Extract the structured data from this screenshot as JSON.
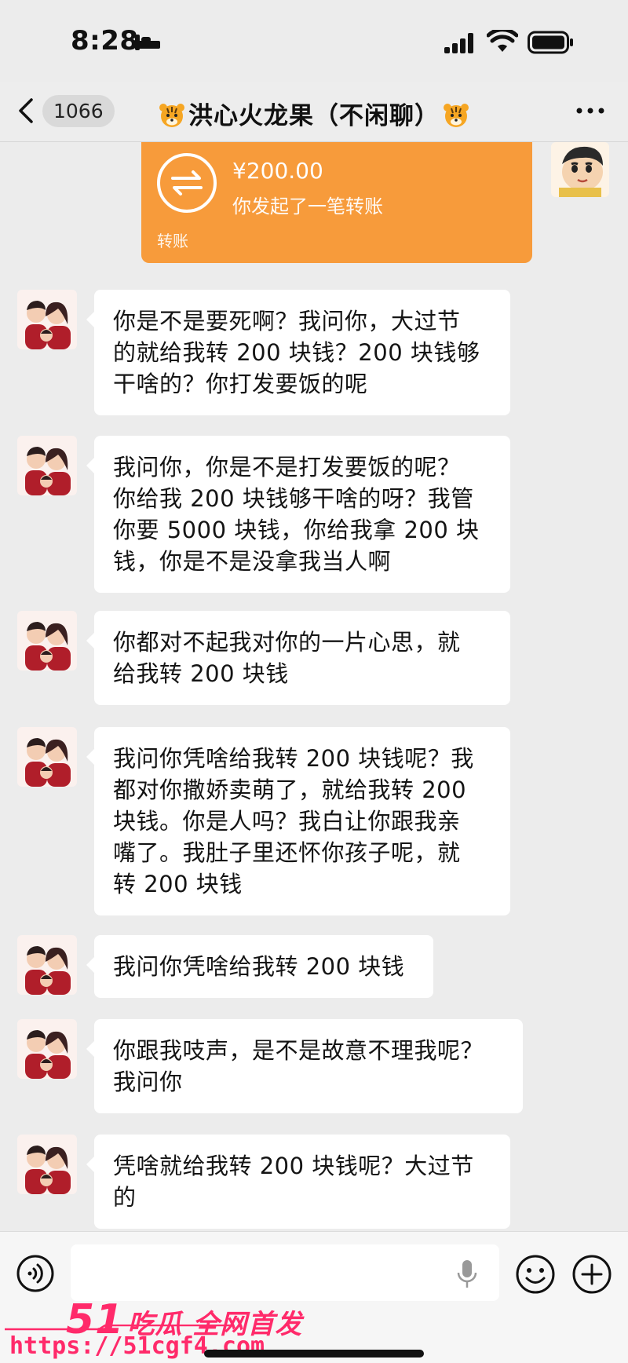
{
  "status_bar": {
    "time": "8:28",
    "icons": [
      "sleep-icon",
      "signal-icon",
      "wifi-icon",
      "battery-icon"
    ]
  },
  "header": {
    "unread_count": "1066",
    "title": "洪心火龙果（不闲聊）",
    "title_icon": "tiger-emoji-icon"
  },
  "transfer": {
    "amount": "¥200.00",
    "description": "你发起了一笔转账",
    "label": "转账",
    "color": "#f79b3b"
  },
  "messages": [
    {
      "text": "你是不是要死啊？我问你，大过节\n的就给我转 200 块钱？200 块钱够\n干啥的？你打发要饭的呢"
    },
    {
      "text": "我问你，你是不是打发要饭的呢？\n你给我 200 块钱够干啥的呀？我管\n你要 5000 块钱，你给我拿 200 块\n钱，你是不是没拿我当人啊"
    },
    {
      "text": "你都对不起我对你的一片心思，就\n给我转 200 块钱"
    },
    {
      "text": "我问你凭啥给我转 200 块钱呢？我\n都对你撒娇卖萌了，就给我转 200\n块钱。你是人吗？我白让你跟我亲\n嘴了。我肚子里还怀你孩子呢，就\n转 200 块钱"
    },
    {
      "text": "我问你凭啥给我转 200 块钱"
    },
    {
      "text": "你跟我吱声，是不是故意不理我呢？\n我问你"
    },
    {
      "text": "凭啥就给我转 200 块钱呢？大过节\n的"
    }
  ],
  "input_bar": {
    "placeholder": "",
    "icons": [
      "voice-icon",
      "mic-icon",
      "emoji-icon",
      "plus-icon"
    ]
  },
  "watermark": {
    "brand_number": "51",
    "brand_text": "吃瓜 全网首发",
    "url": "https://51cgf4.com",
    "color": "#ff2a6a"
  }
}
